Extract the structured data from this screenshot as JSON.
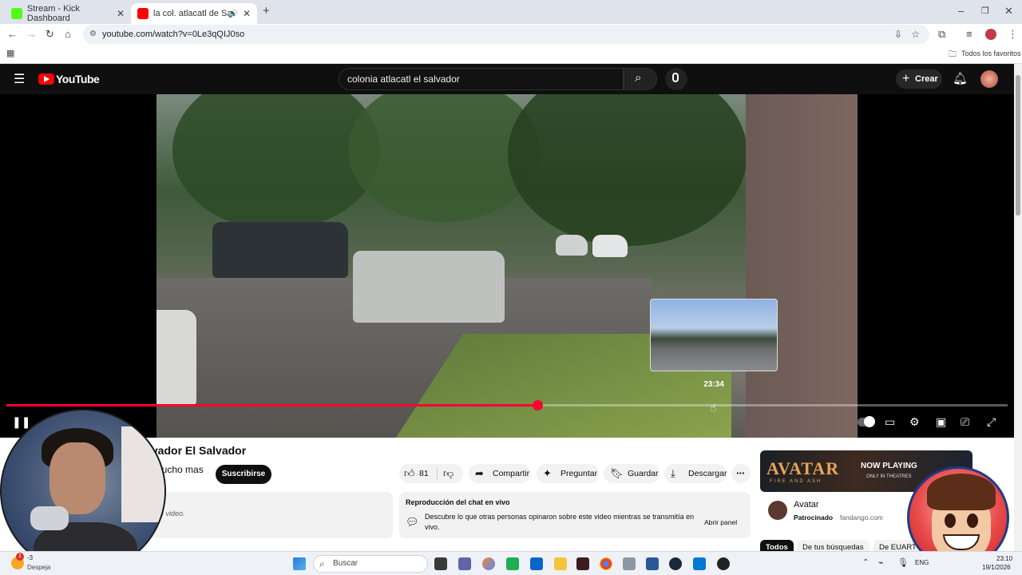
{
  "browser": {
    "tabs": [
      {
        "title": "Stream - Kick Dashboard",
        "active": false,
        "favicon_color": "#53fc18"
      },
      {
        "title": "la col. atlacatl de San Salva",
        "active": true,
        "favicon_color": "#ff0000"
      }
    ],
    "url": "youtube.com/watch?v=0Le3qQIJ0so",
    "bookmarks_label": "Todos los favoritos"
  },
  "youtube": {
    "logo_text": "YouTube",
    "search_query": "colonia atlacatl el salvador",
    "create_label": "Crear"
  },
  "player": {
    "progress_fraction": 0.53,
    "hover_fraction": 0.708,
    "preview_time": "23:34"
  },
  "video": {
    "title": "lvador El Salvador",
    "channel_fragment": "nucho mas",
    "subscribe_label": "Suscribirse",
    "like_count": "81",
    "actions": {
      "share": "Compartir",
      "ask": "Preguntar",
      "save": "Guardar",
      "download": "Descargar"
    },
    "description_fragment": "e video."
  },
  "chat": {
    "title": "Reproducción del chat en vivo",
    "description": "Descubre lo que otras personas opinaron sobre este video mientras se transmitía en vivo.",
    "open_label": "Abrir panel"
  },
  "ad": {
    "banner_title": "AVATAR",
    "banner_subtitle": "FIRE AND ASH",
    "banner_now": "NOW PLAYING",
    "banner_theatres": "ONLY IN THEATRES",
    "name": "Avatar",
    "sponsored": "Patrocinado",
    "domain": "fandango.com"
  },
  "chips": [
    "Todos",
    "De tus búsquedas",
    "De EUART"
  ],
  "taskbar": {
    "search_placeholder": "Buscar",
    "language": "ENG",
    "time": "23:10",
    "date": "19/1/2026",
    "weather_fragment": "Despeja",
    "weather_temp": "-3"
  }
}
